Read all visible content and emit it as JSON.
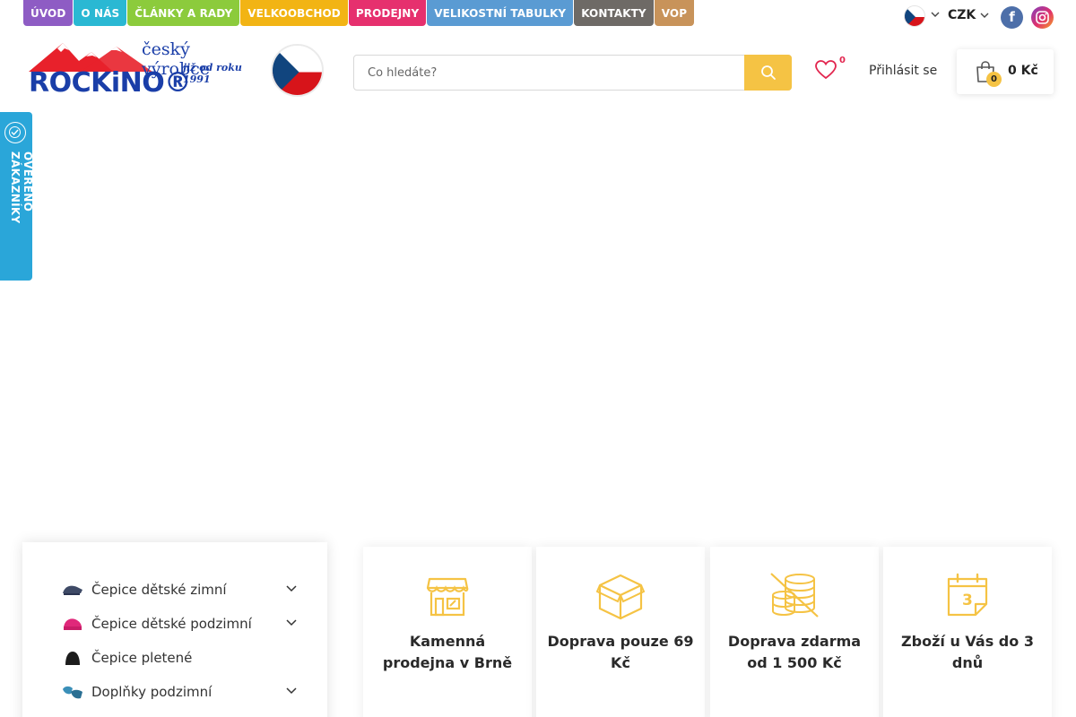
{
  "nav": {
    "items": [
      {
        "label": "ÚVOD",
        "color": "#8e5cc4"
      },
      {
        "label": "O NÁS",
        "color": "#2ab8d3"
      },
      {
        "label": "ČLÁNKY A RADY",
        "color": "#8ccb3c"
      },
      {
        "label": "VELKOOBCHOD",
        "color": "#f2b414"
      },
      {
        "label": "PRODEJNY",
        "color": "#e6306e"
      },
      {
        "label": "VELIKOSTNÍ TABULKY",
        "color": "#5a9bd3"
      },
      {
        "label": "KONTAKTY",
        "color": "#6e6a66"
      },
      {
        "label": "VOP",
        "color": "#c8935a"
      }
    ]
  },
  "header": {
    "language_icon": "czech-flag-icon",
    "currency": "CZK",
    "social": {
      "facebook": "f",
      "instagram": "◎"
    }
  },
  "logo": {
    "brand": "ROCKiNO®",
    "tagline": "český výrobce",
    "since": "již od roku 1991"
  },
  "search": {
    "placeholder": "Co hledáte?"
  },
  "wishlist": {
    "count": "0"
  },
  "account": {
    "login_label": "Přihlásit se"
  },
  "cart": {
    "count": "0",
    "total": "0 Kč"
  },
  "verified": {
    "label": "OVĚŘENO ZÁKAZNÍKY"
  },
  "categories": [
    {
      "label": "Čepice dětské zimní",
      "has_submenu": true,
      "icon": "winter-hat-icon"
    },
    {
      "label": "Čepice dětské podzimní",
      "has_submenu": true,
      "icon": "autumn-hat-icon"
    },
    {
      "label": "Čepice pletené",
      "has_submenu": false,
      "icon": "knit-hat-icon"
    },
    {
      "label": "Doplňky podzimní",
      "has_submenu": true,
      "icon": "accessories-icon"
    }
  ],
  "features": [
    {
      "label": "Kamenná prodejna v Brně",
      "icon": "store-icon"
    },
    {
      "label": "Doprava pouze 69 Kč",
      "icon": "box-icon"
    },
    {
      "label": "Doprava zdarma od 1 500 Kč",
      "icon": "coins-icon"
    },
    {
      "label": "Zboží u Vás do 3 dnů",
      "icon": "calendar-icon"
    }
  ],
  "colors": {
    "accent": "#f5c344",
    "brand_blue": "#1a3ea8",
    "verified_blue": "#2aa6d9"
  }
}
